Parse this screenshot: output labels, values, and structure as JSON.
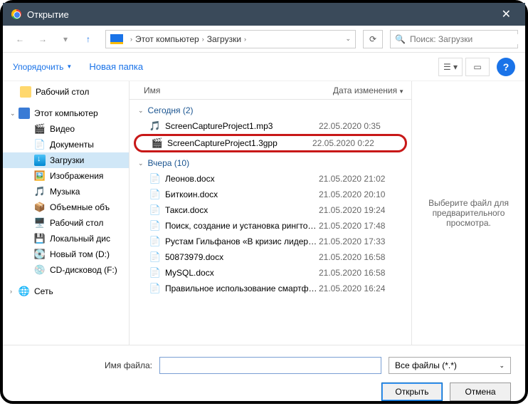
{
  "window": {
    "title": "Открытие"
  },
  "nav": {
    "breadcrumb1": "Этот компьютер",
    "breadcrumb2": "Загрузки",
    "search_placeholder": "Поиск: Загрузки"
  },
  "toolbar": {
    "organize": "Упорядочить",
    "new_folder": "Новая папка"
  },
  "tree": {
    "desktop": "Рабочий стол",
    "this_pc": "Этот компьютер",
    "videos": "Видео",
    "documents": "Документы",
    "downloads": "Загрузки",
    "pictures": "Изображения",
    "music": "Музыка",
    "vol": "Объемные объ",
    "desk2": "Рабочий стол",
    "local": "Локальный дис",
    "tom": "Новый том (D:)",
    "cd": "CD-дисковод (F:)",
    "network": "Сеть"
  },
  "columns": {
    "name": "Имя",
    "date": "Дата изменения"
  },
  "groups": {
    "today": "Сегодня (2)",
    "yesterday": "Вчера (10)"
  },
  "files": {
    "today": [
      {
        "icon": "🎵",
        "name": "ScreenCaptureProject1.mp3",
        "date": "22.05.2020 0:35"
      },
      {
        "icon": "🎬",
        "name": "ScreenCaptureProject1.3gpp",
        "date": "22.05.2020 0:22",
        "hl": true
      }
    ],
    "yesterday": [
      {
        "icon": "📄",
        "name": "Леонов.docx",
        "date": "21.05.2020 21:02"
      },
      {
        "icon": "📄",
        "name": "Биткоин.docx",
        "date": "21.05.2020 20:10"
      },
      {
        "icon": "📄",
        "name": "Такси.docx",
        "date": "21.05.2020 19:24"
      },
      {
        "icon": "📄",
        "name": "Поиск, создание и установка рингтоно...",
        "date": "21.05.2020 17:48"
      },
      {
        "icon": "📄",
        "name": "Рустам Гильфанов «В кризис лидеры д...",
        "date": "21.05.2020 17:33"
      },
      {
        "icon": "📄",
        "name": "50873979.docx",
        "date": "21.05.2020 16:58"
      },
      {
        "icon": "📄",
        "name": "MySQL.docx",
        "date": "21.05.2020 16:58"
      },
      {
        "icon": "📄",
        "name": "Правильное использование смартфон...",
        "date": "21.05.2020 16:24"
      }
    ]
  },
  "preview": {
    "msg": "Выберите файл для предварительного просмотра."
  },
  "footer": {
    "filename_label": "Имя файла:",
    "filter": "Все файлы (*.*)",
    "open": "Открыть",
    "cancel": "Отмена"
  }
}
